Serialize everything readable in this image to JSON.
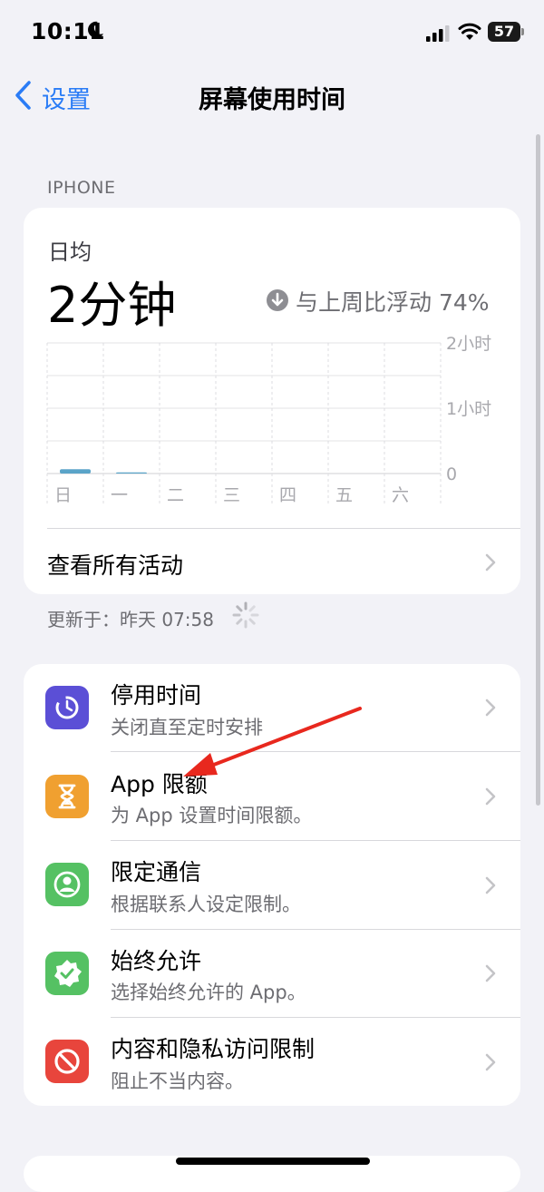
{
  "status_bar": {
    "time": "10:11"
  },
  "nav": {
    "back_label": "设置",
    "title": "屏幕使用时间"
  },
  "section_label": "IPHONE",
  "summary": {
    "daily_label": "日均",
    "daily_value": "2分钟",
    "trend_text": "与上周比浮动 74%",
    "trend_direction": "down"
  },
  "chart_data": {
    "type": "bar",
    "categories": [
      "日",
      "一",
      "二",
      "三",
      "四",
      "五",
      "六"
    ],
    "values_minutes": [
      4,
      1,
      0,
      0,
      0,
      0,
      0
    ],
    "y_tick_labels": [
      "2小时",
      "1小时",
      "0"
    ],
    "ylim_minutes": [
      0,
      120
    ],
    "bar_color": "#5aa4c8",
    "grid": true
  },
  "see_all_label": "查看所有活动",
  "updated_text": "更新于：昨天 07:58",
  "settings": [
    {
      "icon": "downtime-icon",
      "color": "#5b4fd6",
      "title": "停用时间",
      "subtitle": "关闭直至定时安排"
    },
    {
      "icon": "hourglass-icon",
      "color": "#f0a030",
      "title": "App 限额",
      "subtitle": "为 App 设置时间限额。"
    },
    {
      "icon": "contact-icon",
      "color": "#55c163",
      "title": "限定通信",
      "subtitle": "根据联系人设定限制。"
    },
    {
      "icon": "checkmark-seal-icon",
      "color": "#55c163",
      "title": "始终允许",
      "subtitle": "选择始终允许的 App。"
    },
    {
      "icon": "restricted-icon",
      "color": "#e8453c",
      "title": "内容和隐私访问限制",
      "subtitle": "阻止不当内容。"
    }
  ],
  "accent_color": "#2a7cf6",
  "annotation_arrow_color": "#e8281e"
}
